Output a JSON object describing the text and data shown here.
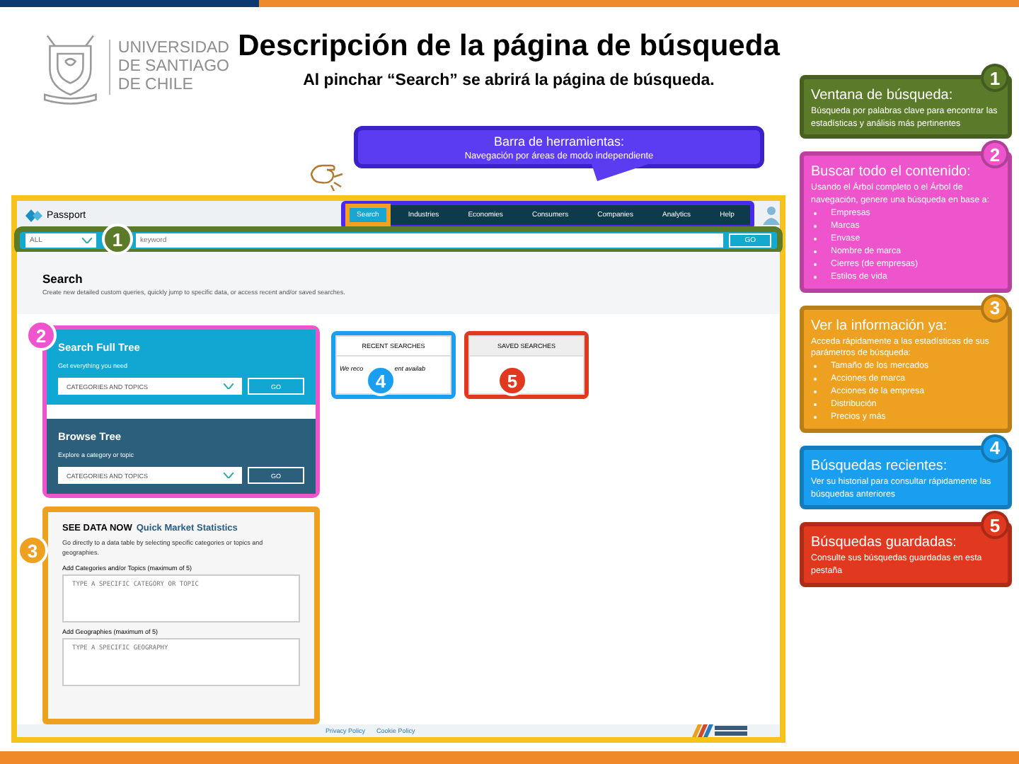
{
  "slide": {
    "university_lines": [
      "UNIVERSIDAD",
      "DE SANTIAGO",
      "DE CHILE"
    ],
    "title": "Descripción de la página de búsqueda",
    "subtitle": "Al pinchar “Search” se abrirá la página de búsqueda."
  },
  "callout": {
    "title": "Barra de herramientas:",
    "text": "Navegación por áreas de modo independiente"
  },
  "passport": {
    "brand": "Passport",
    "nav": [
      {
        "label": "Search",
        "selected": true
      },
      {
        "label": "Industries",
        "selected": false
      },
      {
        "label": "Economies",
        "selected": false
      },
      {
        "label": "Consumers",
        "selected": false
      },
      {
        "label": "Companies",
        "selected": false
      },
      {
        "label": "Analytics",
        "selected": false
      },
      {
        "label": "Help",
        "selected": false
      }
    ],
    "search_bar": {
      "badge": "1",
      "scope": "ALL",
      "placeholder": "keyword",
      "go": "GO"
    },
    "heading": "Search",
    "intro": "Create new detailed custom queries, quickly jump to specific data, or access recent and/or saved searches.",
    "full_tree": {
      "badge": "2",
      "title": "Search Full Tree",
      "text": "Get everything you need",
      "select": "CATEGORIES AND TOPICS",
      "go": "GO"
    },
    "browse_tree": {
      "title": "Browse Tree",
      "text": "Explore a category or topic",
      "select": "CATEGORIES AND TOPICS",
      "go": "GO"
    },
    "recent": {
      "badge": "4",
      "title": "RECENT SEARCHES",
      "text_before": "We reco",
      "text_after": "ent availab"
    },
    "saved": {
      "badge": "5",
      "title": "SAVED SEARCHES"
    },
    "quick_stats": {
      "badge": "3",
      "lead": "SEE DATA NOW",
      "title": "Quick Market Statistics",
      "text": "Go directly to a data table by selecting specific categories or topics and geographies.",
      "fields": [
        {
          "label": "Add Categories and/or Topics (maximum of 5)",
          "placeholder": "TYPE A SPECIFIC CATEGORY OR TOPIC"
        },
        {
          "label": "Add Geographies (maximum of 5)",
          "placeholder": "TYPE A SPECIFIC GEOGRAPHY"
        }
      ]
    },
    "footer_links": [
      "Privacy Policy",
      "Cookie Policy"
    ]
  },
  "notes": [
    {
      "number": "1",
      "color": "#5b7b2a",
      "title": "Ventana de búsqueda:",
      "text": "Búsqueda por palabras clave para encontrar las estadísticas y análisis más pertinentes"
    },
    {
      "number": "2",
      "color": "#ee55cc",
      "title": "Buscar todo el contenido:",
      "text": "Usando el Árbol completo o el Árbol de navegación, genere una búsqueda en base a:",
      "bullets": [
        "Empresas",
        "Marcas",
        "Envase",
        "Nombre de marca",
        "Cierres (de empresas)",
        "Estilos de vida"
      ]
    },
    {
      "number": "3",
      "color": "#eea020",
      "title": "Ver la información ya:",
      "text": "Acceda rápidamente a las estadísticas de sus parámetros de búsqueda:",
      "bullets": [
        "Tamaño de los mercados",
        "Acciones de marca",
        "Acciones de la empresa",
        "Distribución",
        "Precios y más"
      ]
    },
    {
      "number": "4",
      "color": "#1a9ff0",
      "title": "Búsquedas recientes:",
      "text": "Ver su historial para consultar rápidamente las búsquedas anteriores"
    },
    {
      "number": "5",
      "color": "#e0391f",
      "title": "Búsquedas guardadas:",
      "text": "Consulte sus búsquedas guardadas en esta pestaña"
    }
  ]
}
